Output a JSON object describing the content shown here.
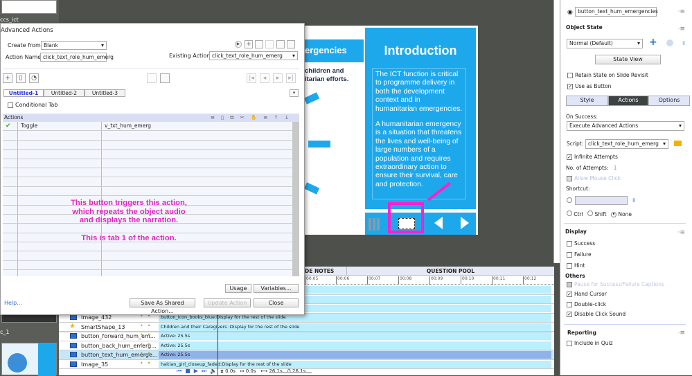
{
  "filmstrip": {
    "labels": [
      "ccs_ict",
      "c_1"
    ]
  },
  "slide": {
    "header_fragment": "ergencies",
    "sub_fragment_1": "children and",
    "sub_fragment_2": "itarian efforts.",
    "intro_title": "Introduction",
    "intro_p1": "The ICT function is critical to programme delivery in both the development context and in humanitarian emergencies.",
    "intro_p2": "A humanitarian emergency is a situation that threatens the lives and well-being of large numbers of a population and requires extraordinary action to ensure their survival, care and protection.",
    "highlight_color": "#ff1fcf",
    "accent": "#1ea8ec"
  },
  "dialog": {
    "title": "Advanced Actions",
    "create_from_label": "Create from:",
    "create_from_value": "Blank",
    "action_name_label": "Action Name:",
    "action_name_value": "click_text_role_hum_emerg",
    "existing_label": "Existing Actions:",
    "existing_value": "click_text_role_hum_emerg",
    "tabs": [
      "Untitled-1",
      "Untitled-2",
      "Untitled-3"
    ],
    "conditional_tab": "Conditional Tab",
    "actions_header": "Actions",
    "rows": [
      {
        "action": "Toggle",
        "target": "v_txt_hum_emerg",
        "status": "check"
      }
    ],
    "usage": "Usage",
    "variables": "Variables...",
    "help": "Help...",
    "save_shared": "Save As Shared Action...",
    "update": "Update Action",
    "close": "Close"
  },
  "annotation": {
    "line1": "This button triggers this action,",
    "line2": "which repeats the object audio",
    "line3": "and displays the narration.",
    "line4": "This is tab 1 of the action."
  },
  "props": {
    "object_name": "button_text_hum_emergencies",
    "object_state": "Object State",
    "state_value": "Normal (Default)",
    "state_view": "State View",
    "retain": "Retain State on Slide Revisit",
    "use_as_button": "Use as Button",
    "tabs": [
      "Style",
      "Actions",
      "Options"
    ],
    "on_success": "On Success:",
    "on_success_value": "Execute Advanced Actions",
    "script_label": "Script:",
    "script_value": "click_text_role_hum_emerg",
    "infinite": "Infinite Attempts",
    "attempts_label": "No. of Attempts:",
    "attempts_value": "1",
    "allow_mouse": "Allow Mouse Click",
    "shortcut": "Shortcut:",
    "ctrl": "Ctrl",
    "shift": "Shift",
    "none": "None",
    "display": "Display",
    "success": "Success",
    "failure": "Failure",
    "hint": "Hint",
    "others": "Others",
    "pause": "Pause for Success/Failure Captions",
    "hand": "Hand Cursor",
    "double": "Double-click",
    "disable_sound": "Disable Click Sound",
    "reporting": "Reporting",
    "include_quiz": "Include in Quiz"
  },
  "timeline": {
    "notes_tab": "DE NOTES",
    "qpool_tab": "QUESTION POOL",
    "ruler": [
      "00:05",
      "00:06",
      "00:07",
      "00:08",
      "00:09",
      "00:10",
      "00:11",
      "00:12"
    ],
    "layers": [
      {
        "name": "Image_432",
        "bar": "button_icon_books_blue:Display for the rest of the slide",
        "icon": "image"
      },
      {
        "name": "SmartShape_13",
        "bar": "Children and their Caregivers :Display for the rest of the slide",
        "icon": "star"
      },
      {
        "name": "button_forward_hum_em...",
        "bar": "Active: 25.5s",
        "icon": "image"
      },
      {
        "name": "button_back_hum_emerg...",
        "bar": "Active: 25.5s",
        "icon": "image"
      },
      {
        "name": "button_text_hum_emerge...",
        "bar": "Active: 25.5s",
        "icon": "image",
        "selected": true
      },
      {
        "name": "Image_35",
        "bar": "haitian_girl_closeup_faded:Display for the rest of the slide",
        "icon": "image"
      }
    ],
    "status": {
      "current": "0.0s",
      "start": "0.0s",
      "duration": "26.1s",
      "end": "26.1s"
    }
  }
}
